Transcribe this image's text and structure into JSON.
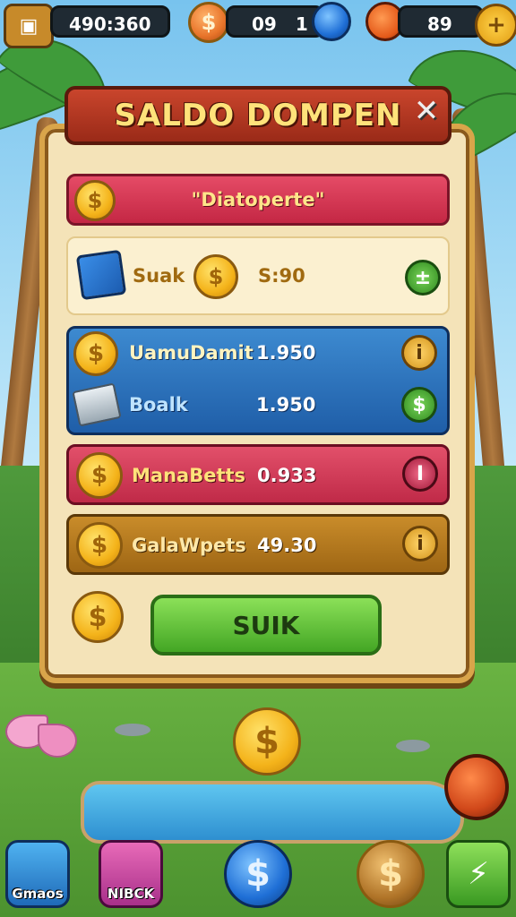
{
  "hud": {
    "balance": "490:360",
    "coin_symbol": "$",
    "counter_a": "09",
    "counter_b": "1",
    "counter_c": "89",
    "add_symbol": "+"
  },
  "modal": {
    "title": "SALDO DOMPEN",
    "close_label": "✕",
    "header_row": {
      "label": "\"Diatoperte\""
    },
    "rows": [
      {
        "label": "Suak",
        "value": "S:90",
        "action": "±"
      },
      {
        "label": "UamuDamit",
        "value": "1.950",
        "action": "i"
      },
      {
        "label": "Boalk",
        "value": "1.950",
        "action": "$"
      },
      {
        "label": "ManaBetts",
        "value": "0.933",
        "action": "I"
      },
      {
        "label": "GalaWpets",
        "value": "49.30",
        "action": "i"
      }
    ],
    "confirm_button": "SUIK"
  },
  "bottom_nav": {
    "games_label": "Gmaos",
    "shop_label": "NIBCK",
    "coin_symbol": "$"
  },
  "colors": {
    "header_row": "#d8334f",
    "blue_rows": "#2f76b8",
    "magenta_row": "#d13b58",
    "gold_row": "#b5791f",
    "confirm": "#5cc23a"
  }
}
